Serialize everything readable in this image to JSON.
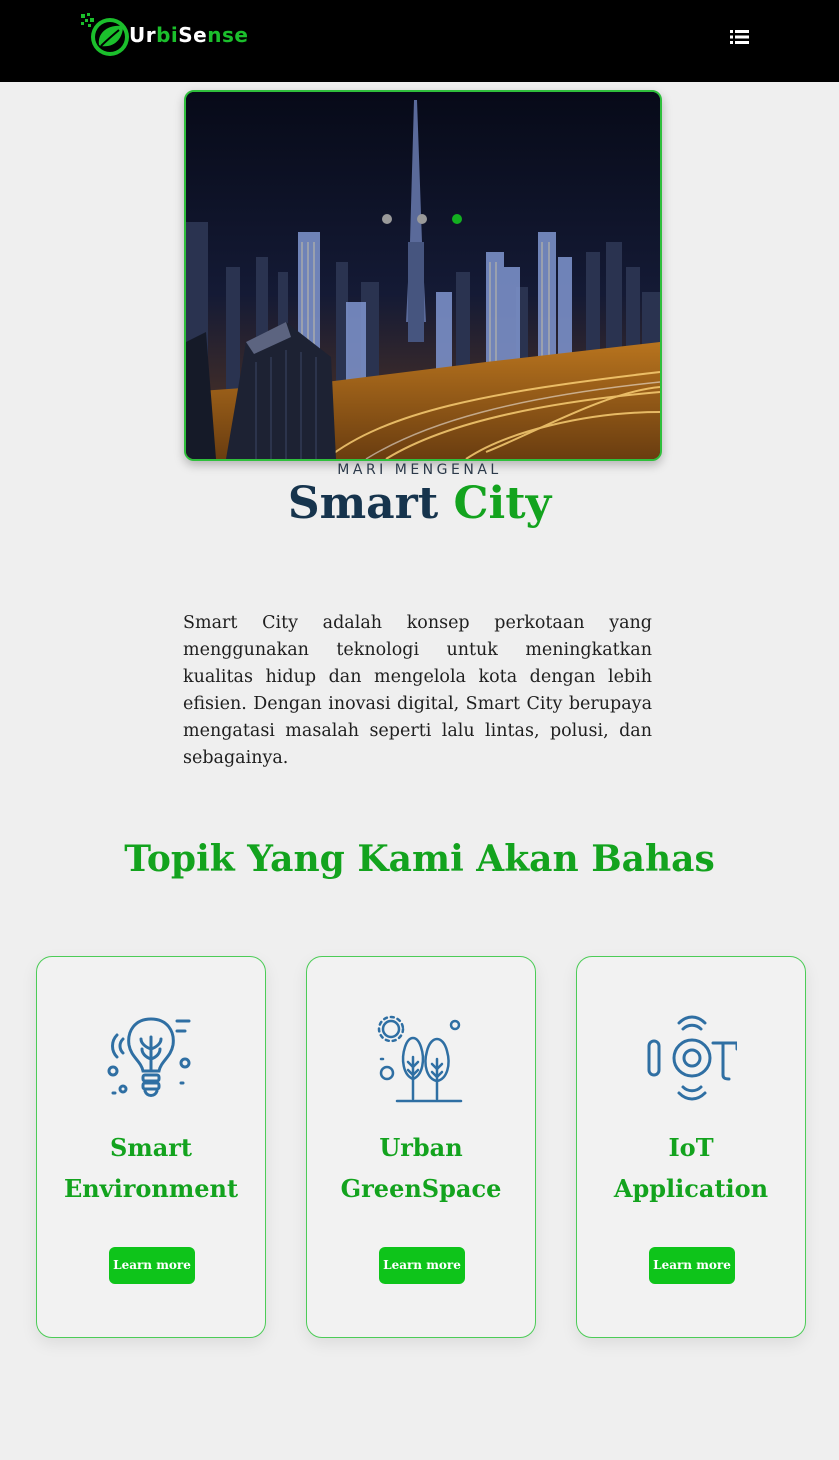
{
  "header": {
    "brand_prefix": "Urbi",
    "brand_mid": "bi",
    "brand": {
      "part1": "Ur",
      "part2": "bi",
      "part3": "Se",
      "part4": "nse"
    },
    "menu_icon": "list-icon"
  },
  "hero": {
    "image": "city-skyline-night",
    "slides_total": 3,
    "active_slide": 3
  },
  "intro": {
    "eyebrow": "MARI MENGENAL",
    "title_part1": "Smart",
    "title_part2": "City",
    "description": "Smart City adalah konsep perkotaan yang menggunakan teknologi untuk meningkatkan kualitas hidup dan mengelola kota dengan lebih efisien. Dengan inovasi digital, Smart City berupaya mengatasi masalah seperti lalu lintas, polusi, dan sebagainya."
  },
  "topics": {
    "heading": "Topik Yang Kami Akan Bahas",
    "cards": [
      {
        "title_line1": "Smart",
        "title_line2": "Environment",
        "button": "Learn more",
        "icon": "lightbulb-plant-icon"
      },
      {
        "title_line1": "Urban",
        "title_line2": "GreenSpace",
        "button": "Learn more",
        "icon": "trees-icon"
      },
      {
        "title_line1": "IoT",
        "title_line2": "Application",
        "button": "Learn more",
        "icon": "iot-icon"
      }
    ]
  },
  "colors": {
    "brand_green": "#13a31e",
    "button_green": "#0ec41a",
    "navy": "#16344d",
    "icon_blue": "#2f6fa3",
    "header_bg": "#000000"
  }
}
